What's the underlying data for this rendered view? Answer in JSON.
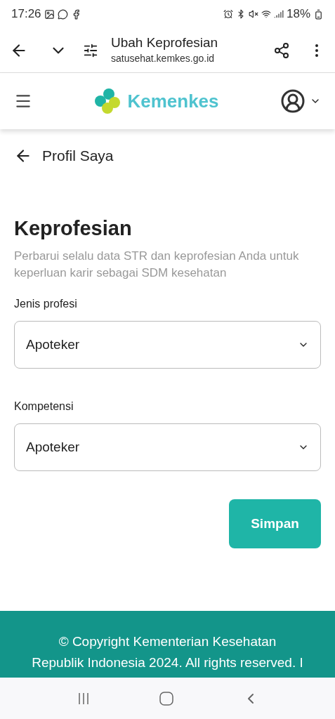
{
  "status_bar": {
    "time": "17:26",
    "battery": "18%"
  },
  "browser": {
    "title": "Ubah Keprofesian",
    "url": "satusehat.kemkes.go.id"
  },
  "header": {
    "logo_text": "Kemenkes"
  },
  "back_link": "Profil Saya",
  "section": {
    "title": "Keprofesian",
    "subtitle": "Perbarui selalu data STR dan keprofesian Anda untuk keperluan karir sebagai SDM kesehatan"
  },
  "fields": [
    {
      "label": "Jenis profesi",
      "value": "Apoteker"
    },
    {
      "label": "Kompetensi",
      "value": "Apoteker"
    }
  ],
  "save_button": "Simpan",
  "footer": {
    "lines": [
      "© Copyright Kementerian Kesehatan",
      "Republik Indonesia 2024. All rights reserved. I"
    ]
  }
}
